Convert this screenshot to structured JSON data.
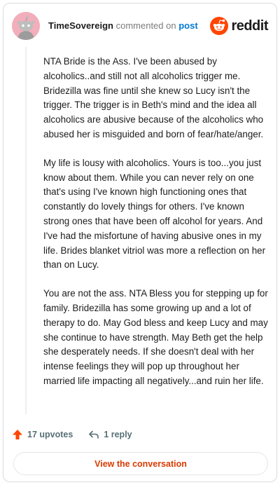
{
  "comment": {
    "author": "TimeSovereign",
    "action_text": "commented on",
    "post_link_text": "post",
    "paragraphs": [
      "NTA Bride is the Ass. I've been abused by alcoholics..and still not all alcoholics trigger me. Bridezilla was fine until she knew so Lucy isn't the trigger. The trigger is in Beth's mind and the idea all alcoholics are abusive because of the alcoholics who abused her is misguided and born of fear/hate/anger.",
      "My life is lousy with alcoholics. Yours is too...you just know about them. While you can never rely on one that's using I've known high functioning ones that constantly do lovely things for others. I've known strong ones that have been off alcohol for years. And I've had the misfortune of having abusive ones in my life. Brides blanket vitriol was more a reflection on her than on Lucy.",
      "You are not the ass. NTA Bless you for stepping up for family. Bridezilla has some growing up and a lot of therapy to do. May God bless and keep Lucy and may she continue to have strength. May Beth get the help she desperately needs. If she doesn't deal with her intense feelings they will pop up throughout her married life impacting all negatively...and ruin her life."
    ],
    "upvotes_text": "17 upvotes",
    "replies_text": "1 reply"
  },
  "brand": {
    "name": "reddit",
    "icon": "reddit-logo-icon",
    "color": "#ff4500"
  },
  "actions": {
    "view_conversation_label": "View the conversation"
  },
  "colors": {
    "accent": "#ff4500",
    "link": "#0079d3",
    "button_text": "#d93a00",
    "avatar_bg": "#f2aebb"
  }
}
